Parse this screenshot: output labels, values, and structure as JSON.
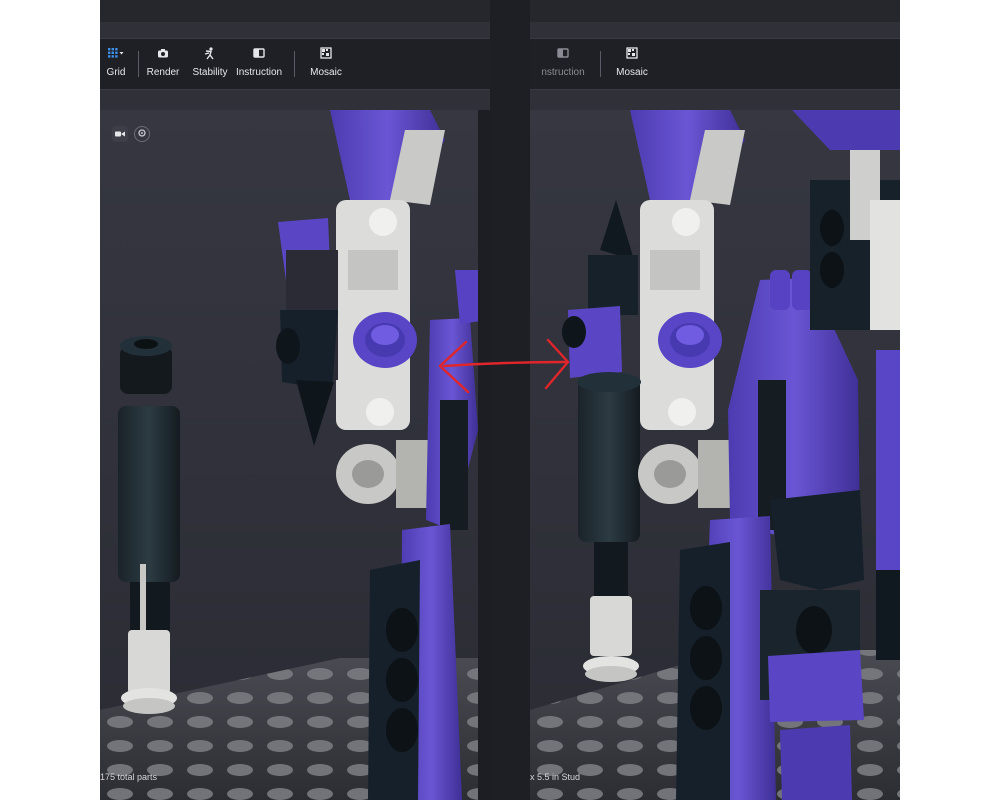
{
  "left": {
    "toolbar": [
      {
        "id": "grid",
        "label": "Grid",
        "icon": "grid-icon"
      },
      {
        "id": "render",
        "label": "Render",
        "icon": "camera-icon"
      },
      {
        "id": "stability",
        "label": "Stability",
        "icon": "stability-icon"
      },
      {
        "id": "instruction",
        "label": "Instruction",
        "icon": "book-icon"
      },
      {
        "id": "mosaic",
        "label": "Mosaic",
        "icon": "mosaic-icon"
      }
    ],
    "status": "175 total parts",
    "viewport_controls": [
      "video-camera-icon",
      "rotate-icon"
    ]
  },
  "right": {
    "toolbar": [
      {
        "id": "instruction",
        "label": "nstruction",
        "icon": "book-icon"
      },
      {
        "id": "mosaic",
        "label": "Mosaic",
        "icon": "mosaic-icon"
      }
    ],
    "status": "x 5.5 in Stud"
  },
  "annotation": {
    "type": "double-arrow",
    "color": "#e0252b"
  },
  "colors": {
    "background": "#2f3038",
    "toolbar": "#1f2026",
    "purple": "#5b47c4",
    "dark_teal": "#1d2b32",
    "light_gray": "#cfd0cd",
    "baseplate": "#7d7e82"
  }
}
